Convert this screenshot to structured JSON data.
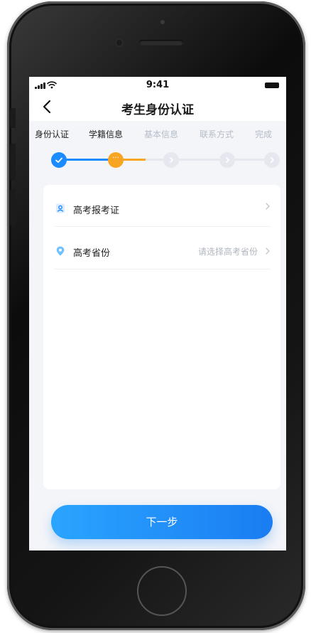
{
  "status_bar": {
    "time": "9:41"
  },
  "header": {
    "title": "考生身份认证"
  },
  "stepper": {
    "steps": [
      {
        "label": "身份认证",
        "state": "done"
      },
      {
        "label": "学籍信息",
        "state": "active"
      },
      {
        "label": "基本信息",
        "state": "pending"
      },
      {
        "label": "联系方式",
        "state": "pending"
      },
      {
        "label": "完成",
        "state": "pending"
      }
    ],
    "active_glyph": "···"
  },
  "form": {
    "rows": [
      {
        "icon": "id-card-icon",
        "label": "高考报考证",
        "value": ""
      },
      {
        "icon": "location-pin-icon",
        "label": "高考省份",
        "value": "请选择高考省份"
      }
    ]
  },
  "footer": {
    "next_label": "下一步"
  },
  "colors": {
    "accent_blue": "#1a8cff",
    "active_orange": "#f6a623",
    "pending_gray": "#e5e8ee",
    "background": "#f3f5f9"
  }
}
